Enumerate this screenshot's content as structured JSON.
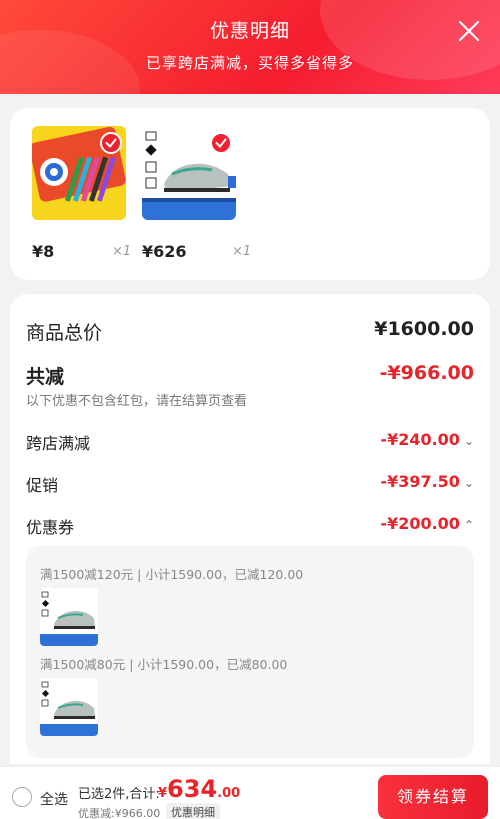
{
  "header": {
    "title": "优惠明细",
    "subtitle": "已享跨店满减，买得多省得多"
  },
  "products": [
    {
      "price": "¥8",
      "qty": "×1"
    },
    {
      "price": "¥626",
      "qty": "×1"
    }
  ],
  "summary_rows": {
    "total_label": "商品总价",
    "total_value": "¥1600.00",
    "discount_label": "共减",
    "discount_value": "-¥966.00",
    "discount_hint": "以下优惠不包含红包，请在结算页查看",
    "cross_store_label": "跨店满减",
    "cross_store_value": "-¥240.00",
    "promo_label": "促销",
    "promo_value": "-¥397.50",
    "coupon_label": "优惠券",
    "coupon_value": "-¥200.00"
  },
  "coupon_details": [
    {
      "text": "满1500减120元 | 小计1590.00，已减120.00"
    },
    {
      "text": "满1500减80元 | 小计1590.00，已减80.00"
    }
  ],
  "footer": {
    "select_all": "全选",
    "selected_summary": "已选2件,合计:",
    "total_currency": "¥",
    "total_int": "634",
    "total_dec": ".00",
    "saved": "优惠减:¥966.00",
    "detail_tag": "优惠明细",
    "checkout": "领券结算"
  },
  "colors": {
    "accent": "#e8232a",
    "header": "#f41d2e"
  }
}
